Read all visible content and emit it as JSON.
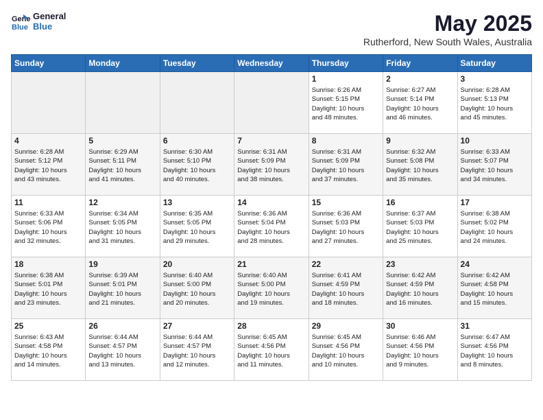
{
  "logo": {
    "line1": "General",
    "line2": "Blue"
  },
  "title": "May 2025",
  "subtitle": "Rutherford, New South Wales, Australia",
  "days_header": [
    "Sunday",
    "Monday",
    "Tuesday",
    "Wednesday",
    "Thursday",
    "Friday",
    "Saturday"
  ],
  "weeks": [
    [
      {
        "day": "",
        "info": ""
      },
      {
        "day": "",
        "info": ""
      },
      {
        "day": "",
        "info": ""
      },
      {
        "day": "",
        "info": ""
      },
      {
        "day": "1",
        "info": "Sunrise: 6:26 AM\nSunset: 5:15 PM\nDaylight: 10 hours\nand 48 minutes."
      },
      {
        "day": "2",
        "info": "Sunrise: 6:27 AM\nSunset: 5:14 PM\nDaylight: 10 hours\nand 46 minutes."
      },
      {
        "day": "3",
        "info": "Sunrise: 6:28 AM\nSunset: 5:13 PM\nDaylight: 10 hours\nand 45 minutes."
      }
    ],
    [
      {
        "day": "4",
        "info": "Sunrise: 6:28 AM\nSunset: 5:12 PM\nDaylight: 10 hours\nand 43 minutes."
      },
      {
        "day": "5",
        "info": "Sunrise: 6:29 AM\nSunset: 5:11 PM\nDaylight: 10 hours\nand 41 minutes."
      },
      {
        "day": "6",
        "info": "Sunrise: 6:30 AM\nSunset: 5:10 PM\nDaylight: 10 hours\nand 40 minutes."
      },
      {
        "day": "7",
        "info": "Sunrise: 6:31 AM\nSunset: 5:09 PM\nDaylight: 10 hours\nand 38 minutes."
      },
      {
        "day": "8",
        "info": "Sunrise: 6:31 AM\nSunset: 5:09 PM\nDaylight: 10 hours\nand 37 minutes."
      },
      {
        "day": "9",
        "info": "Sunrise: 6:32 AM\nSunset: 5:08 PM\nDaylight: 10 hours\nand 35 minutes."
      },
      {
        "day": "10",
        "info": "Sunrise: 6:33 AM\nSunset: 5:07 PM\nDaylight: 10 hours\nand 34 minutes."
      }
    ],
    [
      {
        "day": "11",
        "info": "Sunrise: 6:33 AM\nSunset: 5:06 PM\nDaylight: 10 hours\nand 32 minutes."
      },
      {
        "day": "12",
        "info": "Sunrise: 6:34 AM\nSunset: 5:05 PM\nDaylight: 10 hours\nand 31 minutes."
      },
      {
        "day": "13",
        "info": "Sunrise: 6:35 AM\nSunset: 5:05 PM\nDaylight: 10 hours\nand 29 minutes."
      },
      {
        "day": "14",
        "info": "Sunrise: 6:36 AM\nSunset: 5:04 PM\nDaylight: 10 hours\nand 28 minutes."
      },
      {
        "day": "15",
        "info": "Sunrise: 6:36 AM\nSunset: 5:03 PM\nDaylight: 10 hours\nand 27 minutes."
      },
      {
        "day": "16",
        "info": "Sunrise: 6:37 AM\nSunset: 5:03 PM\nDaylight: 10 hours\nand 25 minutes."
      },
      {
        "day": "17",
        "info": "Sunrise: 6:38 AM\nSunset: 5:02 PM\nDaylight: 10 hours\nand 24 minutes."
      }
    ],
    [
      {
        "day": "18",
        "info": "Sunrise: 6:38 AM\nSunset: 5:01 PM\nDaylight: 10 hours\nand 23 minutes."
      },
      {
        "day": "19",
        "info": "Sunrise: 6:39 AM\nSunset: 5:01 PM\nDaylight: 10 hours\nand 21 minutes."
      },
      {
        "day": "20",
        "info": "Sunrise: 6:40 AM\nSunset: 5:00 PM\nDaylight: 10 hours\nand 20 minutes."
      },
      {
        "day": "21",
        "info": "Sunrise: 6:40 AM\nSunset: 5:00 PM\nDaylight: 10 hours\nand 19 minutes."
      },
      {
        "day": "22",
        "info": "Sunrise: 6:41 AM\nSunset: 4:59 PM\nDaylight: 10 hours\nand 18 minutes."
      },
      {
        "day": "23",
        "info": "Sunrise: 6:42 AM\nSunset: 4:59 PM\nDaylight: 10 hours\nand 16 minutes."
      },
      {
        "day": "24",
        "info": "Sunrise: 6:42 AM\nSunset: 4:58 PM\nDaylight: 10 hours\nand 15 minutes."
      }
    ],
    [
      {
        "day": "25",
        "info": "Sunrise: 6:43 AM\nSunset: 4:58 PM\nDaylight: 10 hours\nand 14 minutes."
      },
      {
        "day": "26",
        "info": "Sunrise: 6:44 AM\nSunset: 4:57 PM\nDaylight: 10 hours\nand 13 minutes."
      },
      {
        "day": "27",
        "info": "Sunrise: 6:44 AM\nSunset: 4:57 PM\nDaylight: 10 hours\nand 12 minutes."
      },
      {
        "day": "28",
        "info": "Sunrise: 6:45 AM\nSunset: 4:56 PM\nDaylight: 10 hours\nand 11 minutes."
      },
      {
        "day": "29",
        "info": "Sunrise: 6:45 AM\nSunset: 4:56 PM\nDaylight: 10 hours\nand 10 minutes."
      },
      {
        "day": "30",
        "info": "Sunrise: 6:46 AM\nSunset: 4:56 PM\nDaylight: 10 hours\nand 9 minutes."
      },
      {
        "day": "31",
        "info": "Sunrise: 6:47 AM\nSunset: 4:56 PM\nDaylight: 10 hours\nand 8 minutes."
      }
    ]
  ]
}
